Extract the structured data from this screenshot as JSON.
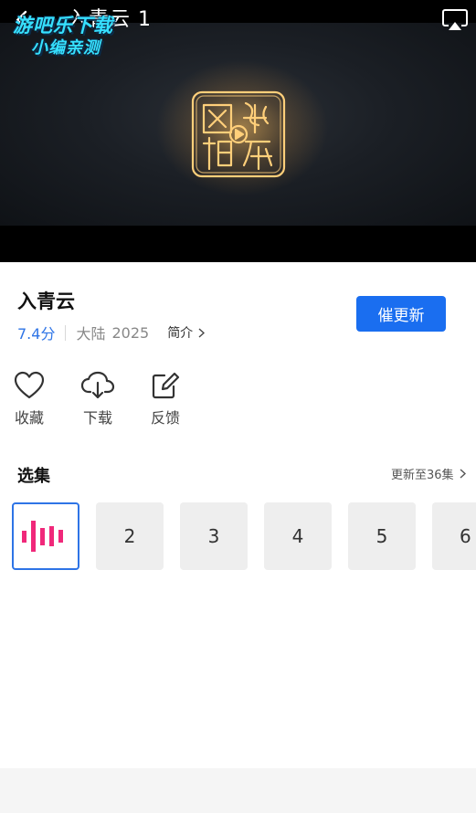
{
  "player": {
    "title": "入青云 1",
    "watermark_line1": "游吧乐下载",
    "watermark_line2": "小编亲测",
    "back_icon": "back-arrow-icon",
    "cast_icon": "airplay-icon",
    "logo_icon": "network-video-seal-logo",
    "accent_glow": "#f2b35a"
  },
  "show": {
    "title": "入青云",
    "score": "7.4分",
    "region": "大陆",
    "year": "2025",
    "intro_label": "简介",
    "urge_update_label": "催更新",
    "accent_color": "#1a6ef0"
  },
  "actions": [
    {
      "label": "收藏",
      "icon": "heart-icon"
    },
    {
      "label": "下载",
      "icon": "cloud-download-icon"
    },
    {
      "label": "反馈",
      "icon": "edit-feedback-icon"
    }
  ],
  "episodes": {
    "heading": "选集",
    "update_status": "更新至36集",
    "playing_icon": "equalizer-bars-icon",
    "playing_color": "#f0287a",
    "items": [
      "1",
      "2",
      "3",
      "4",
      "5",
      "6"
    ]
  }
}
